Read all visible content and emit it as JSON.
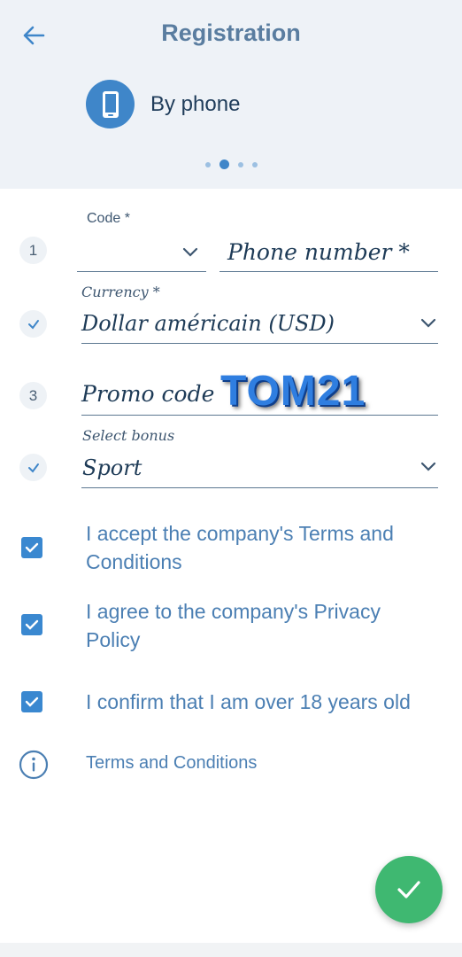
{
  "header": {
    "title": "Registration",
    "back_icon": "arrow-left-icon",
    "method_icon": "phone-icon",
    "method_label": "By phone",
    "steps_indicator": {
      "total": 4,
      "active": 2
    }
  },
  "form": {
    "code": {
      "step": "1",
      "label": "Code *",
      "value": ""
    },
    "phone": {
      "placeholder": "Phone number *"
    },
    "currency": {
      "step_state": "done",
      "label": "Currency *",
      "value": "Dollar américain (USD)"
    },
    "promo": {
      "step": "3",
      "placeholder": "Promo code",
      "value": "TOM21"
    },
    "bonus": {
      "step_state": "done",
      "label": "Select bonus",
      "value": "Sport"
    }
  },
  "agreements": [
    {
      "text": "I accept the company's Terms and Conditions",
      "checked": true
    },
    {
      "text": "I agree to the company's Privacy Policy",
      "checked": true
    },
    {
      "text": "I confirm that I am over 18 years old",
      "checked": true
    }
  ],
  "terms_link": "Terms and Conditions",
  "colors": {
    "accent": "#3f86c9",
    "confirm": "#3fb871",
    "header_bg": "#eef2f7"
  }
}
